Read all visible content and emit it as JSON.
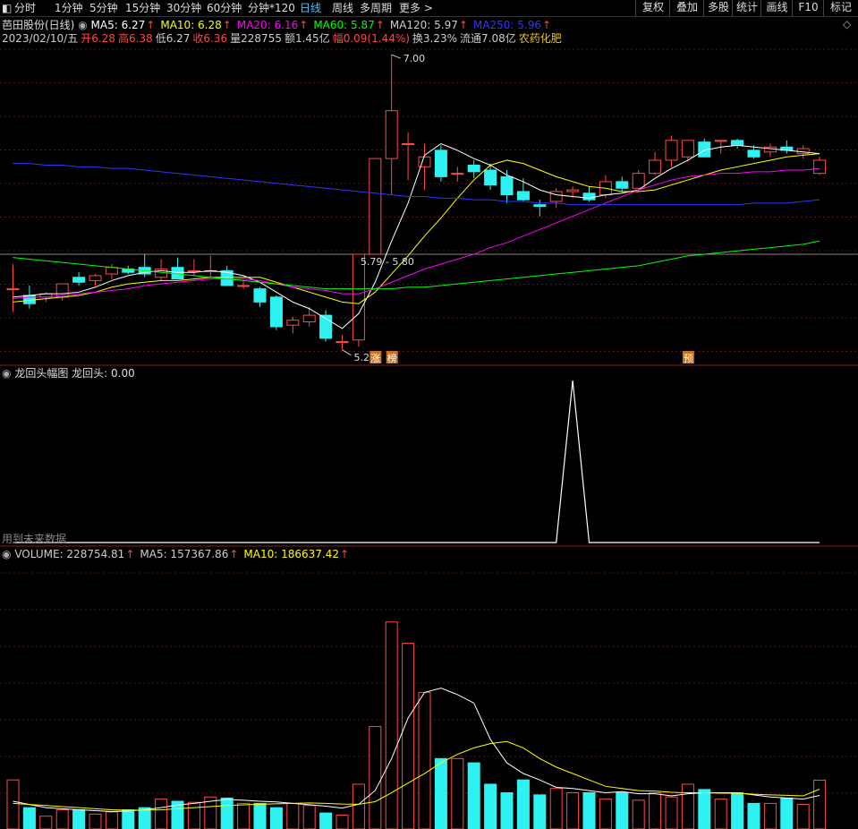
{
  "toolbar": {
    "periods": [
      "分时",
      "1分钟",
      "5分钟",
      "15分钟",
      "30分钟",
      "60分钟",
      "分钟*120",
      "日线",
      "周线",
      "多周期",
      "更多 >"
    ],
    "active": "日线",
    "right": [
      "复权",
      "叠加",
      "多股",
      "统计",
      "画线",
      "F10",
      "标记"
    ]
  },
  "header": {
    "title": "芭田股份(日线)",
    "ma": [
      {
        "label": "MA5: 6.27",
        "color": "#ffffff"
      },
      {
        "label": "MA10: 6.28",
        "color": "#ffff00"
      },
      {
        "label": "MA20: 6.16",
        "color": "#ff00ff"
      },
      {
        "label": "MA60: 5.87",
        "color": "#00ff00"
      },
      {
        "label": "MA120: 5.97",
        "color": "#cccccc"
      },
      {
        "label": "MA250: 5.96",
        "color": "#3333ff"
      }
    ],
    "quote": [
      {
        "text": "2023/02/10/五",
        "color": "#cccccc"
      },
      {
        "text": "开6.28",
        "color": "#ff4444"
      },
      {
        "text": "高6.38",
        "color": "#ff4444"
      },
      {
        "text": "低6.27",
        "color": "#cccccc"
      },
      {
        "text": "收6.36",
        "color": "#ff4444"
      },
      {
        "text": "量228755",
        "color": "#cccccc"
      },
      {
        "text": "额1.45亿",
        "color": "#cccccc"
      },
      {
        "text": "幅0.09(1.44%)",
        "color": "#ff4444"
      },
      {
        "text": "换3.23%",
        "color": "#cccccc"
      },
      {
        "text": "流通7.08亿",
        "color": "#cccccc"
      },
      {
        "text": "农药化肥",
        "color": "#e6c619"
      }
    ]
  },
  "panels": {
    "indicator_title": "龙回头幅图",
    "indicator_value": "龙回头: 0.00",
    "indicator_note": "用到未来数据",
    "volume": [
      {
        "text": "VOLUME: 228754.81",
        "color": "#cccccc"
      },
      {
        "text": "MA5: 157367.86",
        "color": "#cccccc"
      },
      {
        "text": "MA10: 186637.42",
        "color": "#ffff00"
      }
    ]
  },
  "annotations": {
    "high": "7.00",
    "low": "5.21",
    "range": "5.79 - 5.80",
    "tag_zhang": "涨",
    "tag_bang": "榜",
    "tag_yu": "预"
  },
  "chart_data": [
    {
      "type": "candlestick",
      "title": "芭田股份(日线)",
      "ylim": [
        5.16,
        7.06
      ],
      "candles": [
        {
          "o": 5.58,
          "h": 5.73,
          "l": 5.44,
          "c": 5.58
        },
        {
          "o": 5.54,
          "h": 5.6,
          "l": 5.46,
          "c": 5.49
        },
        {
          "o": 5.53,
          "h": 5.56,
          "l": 5.5,
          "c": 5.55
        },
        {
          "o": 5.53,
          "h": 5.61,
          "l": 5.51,
          "c": 5.61
        },
        {
          "o": 5.65,
          "h": 5.68,
          "l": 5.6,
          "c": 5.62
        },
        {
          "o": 5.63,
          "h": 5.67,
          "l": 5.6,
          "c": 5.66
        },
        {
          "o": 5.67,
          "h": 5.73,
          "l": 5.64,
          "c": 5.71
        },
        {
          "o": 5.7,
          "h": 5.72,
          "l": 5.67,
          "c": 5.68
        },
        {
          "o": 5.71,
          "h": 5.79,
          "l": 5.65,
          "c": 5.67
        },
        {
          "o": 5.65,
          "h": 5.76,
          "l": 5.63,
          "c": 5.7
        },
        {
          "o": 5.71,
          "h": 5.77,
          "l": 5.65,
          "c": 5.64
        },
        {
          "o": 5.69,
          "h": 5.76,
          "l": 5.66,
          "c": 5.69
        },
        {
          "o": 5.69,
          "h": 5.78,
          "l": 5.65,
          "c": 5.69
        },
        {
          "o": 5.69,
          "h": 5.72,
          "l": 5.66,
          "c": 5.6
        },
        {
          "o": 5.6,
          "h": 5.63,
          "l": 5.58,
          "c": 5.6
        },
        {
          "o": 5.58,
          "h": 5.59,
          "l": 5.47,
          "c": 5.5
        },
        {
          "o": 5.53,
          "h": 5.54,
          "l": 5.33,
          "c": 5.35
        },
        {
          "o": 5.36,
          "h": 5.41,
          "l": 5.31,
          "c": 5.39
        },
        {
          "o": 5.38,
          "h": 5.47,
          "l": 5.35,
          "c": 5.42
        },
        {
          "o": 5.42,
          "h": 5.45,
          "l": 5.26,
          "c": 5.28
        },
        {
          "o": 5.26,
          "h": 5.3,
          "l": 5.21,
          "c": 5.26
        },
        {
          "o": 5.27,
          "h": 5.79,
          "l": 5.23,
          "c": 5.79
        },
        {
          "o": 5.79,
          "h": 6.37,
          "l": 5.79,
          "c": 6.37
        },
        {
          "o": 6.37,
          "h": 7.0,
          "l": 6.15,
          "c": 6.66
        },
        {
          "o": 6.46,
          "h": 6.53,
          "l": 6.24,
          "c": 6.46
        },
        {
          "o": 6.32,
          "h": 6.46,
          "l": 6.18,
          "c": 6.38
        },
        {
          "o": 6.42,
          "h": 6.45,
          "l": 6.23,
          "c": 6.26
        },
        {
          "o": 6.28,
          "h": 6.32,
          "l": 6.23,
          "c": 6.28
        },
        {
          "o": 6.33,
          "h": 6.36,
          "l": 6.25,
          "c": 6.29
        },
        {
          "o": 6.3,
          "h": 6.34,
          "l": 6.18,
          "c": 6.21
        },
        {
          "o": 6.26,
          "h": 6.3,
          "l": 6.1,
          "c": 6.15
        },
        {
          "o": 6.17,
          "h": 6.25,
          "l": 6.11,
          "c": 6.12
        },
        {
          "o": 6.09,
          "h": 6.12,
          "l": 6.02,
          "c": 6.08
        },
        {
          "o": 6.11,
          "h": 6.19,
          "l": 6.07,
          "c": 6.17
        },
        {
          "o": 6.17,
          "h": 6.2,
          "l": 6.13,
          "c": 6.18
        },
        {
          "o": 6.16,
          "h": 6.2,
          "l": 6.11,
          "c": 6.12
        },
        {
          "o": 6.15,
          "h": 6.27,
          "l": 6.13,
          "c": 6.23
        },
        {
          "o": 6.23,
          "h": 6.26,
          "l": 6.17,
          "c": 6.19
        },
        {
          "o": 6.19,
          "h": 6.3,
          "l": 6.17,
          "c": 6.28
        },
        {
          "o": 6.28,
          "h": 6.41,
          "l": 6.27,
          "c": 6.36
        },
        {
          "o": 6.36,
          "h": 6.51,
          "l": 6.32,
          "c": 6.48
        },
        {
          "o": 6.38,
          "h": 6.48,
          "l": 6.35,
          "c": 6.48
        },
        {
          "o": 6.47,
          "h": 6.49,
          "l": 6.38,
          "c": 6.38
        },
        {
          "o": 6.48,
          "h": 6.48,
          "l": 6.4,
          "c": 6.48
        },
        {
          "o": 6.48,
          "h": 6.49,
          "l": 6.43,
          "c": 6.45
        },
        {
          "o": 6.42,
          "h": 6.45,
          "l": 6.37,
          "c": 6.38
        },
        {
          "o": 6.41,
          "h": 6.46,
          "l": 6.38,
          "c": 6.44
        },
        {
          "o": 6.44,
          "h": 6.48,
          "l": 6.4,
          "c": 6.42
        },
        {
          "o": 6.4,
          "h": 6.45,
          "l": 6.37,
          "c": 6.43
        },
        {
          "o": 6.28,
          "h": 6.38,
          "l": 6.27,
          "c": 6.36
        }
      ],
      "ma_series": [
        {
          "name": "MA5",
          "color": "#ffffff",
          "values": [
            5.53,
            5.54,
            5.55,
            5.55,
            5.56,
            5.59,
            5.63,
            5.66,
            5.68,
            5.69,
            5.68,
            5.68,
            5.69,
            5.68,
            5.66,
            5.62,
            5.56,
            5.5,
            5.46,
            5.4,
            5.34,
            5.43,
            5.62,
            5.87,
            6.1,
            6.39,
            6.46,
            6.42,
            6.37,
            6.33,
            6.27,
            6.23,
            6.18,
            6.15,
            6.14,
            6.13,
            6.15,
            6.16,
            6.18,
            6.25,
            6.31,
            6.36,
            6.42,
            6.44,
            6.45,
            6.44,
            6.43,
            6.42,
            6.41,
            6.4
          ]
        },
        {
          "name": "MA10",
          "color": "#ffff00",
          "values": [
            5.5,
            5.51,
            5.52,
            5.53,
            5.54,
            5.56,
            5.59,
            5.61,
            5.62,
            5.63,
            5.63,
            5.64,
            5.65,
            5.65,
            5.65,
            5.65,
            5.62,
            5.59,
            5.56,
            5.53,
            5.5,
            5.49,
            5.56,
            5.67,
            5.78,
            5.9,
            6.01,
            6.13,
            6.24,
            6.33,
            6.36,
            6.34,
            6.3,
            6.26,
            6.23,
            6.2,
            6.19,
            6.17,
            6.17,
            6.18,
            6.21,
            6.24,
            6.27,
            6.3,
            6.32,
            6.34,
            6.36,
            6.38,
            6.39,
            6.4
          ]
        },
        {
          "name": "MA20",
          "color": "#ff00ff",
          "values": [
            5.52,
            5.53,
            5.53,
            5.54,
            5.55,
            5.56,
            5.57,
            5.58,
            5.6,
            5.61,
            5.62,
            5.63,
            5.64,
            5.64,
            5.64,
            5.63,
            5.61,
            5.59,
            5.58,
            5.57,
            5.55,
            5.55,
            5.58,
            5.62,
            5.66,
            5.7,
            5.73,
            5.76,
            5.79,
            5.83,
            5.86,
            5.9,
            5.94,
            5.98,
            6.02,
            6.06,
            6.1,
            6.14,
            6.18,
            6.21,
            6.24,
            6.26,
            6.27,
            6.28,
            6.28,
            6.29,
            6.29,
            6.3,
            6.3,
            6.31
          ]
        },
        {
          "name": "MA60",
          "color": "#00ff00",
          "values": [
            5.77,
            5.76,
            5.75,
            5.74,
            5.73,
            5.72,
            5.71,
            5.7,
            5.69,
            5.68,
            5.67,
            5.66,
            5.65,
            5.64,
            5.63,
            5.62,
            5.61,
            5.6,
            5.59,
            5.58,
            5.58,
            5.58,
            5.58,
            5.58,
            5.59,
            5.59,
            5.6,
            5.61,
            5.62,
            5.63,
            5.64,
            5.65,
            5.66,
            5.67,
            5.68,
            5.69,
            5.7,
            5.71,
            5.72,
            5.74,
            5.76,
            5.78,
            5.79,
            5.8,
            5.81,
            5.82,
            5.83,
            5.84,
            5.85,
            5.87
          ]
        },
        {
          "name": "MA250",
          "color": "#3333ff",
          "values": [
            6.34,
            6.34,
            6.33,
            6.33,
            6.32,
            6.32,
            6.31,
            6.31,
            6.3,
            6.29,
            6.28,
            6.27,
            6.26,
            6.25,
            6.24,
            6.23,
            6.22,
            6.21,
            6.2,
            6.19,
            6.18,
            6.17,
            6.16,
            6.15,
            6.14,
            6.14,
            6.13,
            6.13,
            6.12,
            6.12,
            6.11,
            6.11,
            6.1,
            6.1,
            6.09,
            6.09,
            6.09,
            6.09,
            6.09,
            6.09,
            6.09,
            6.09,
            6.09,
            6.09,
            6.09,
            6.1,
            6.1,
            6.1,
            6.11,
            6.12
          ]
        }
      ]
    },
    {
      "type": "line",
      "title": "龙回头",
      "values": [
        0,
        0,
        0,
        0,
        0,
        0,
        0,
        0,
        0,
        0,
        0,
        0,
        0,
        0,
        0,
        0,
        0,
        0,
        0,
        0,
        0,
        0,
        0,
        0,
        0,
        0,
        0,
        0,
        0,
        0,
        0,
        0,
        0,
        0,
        1,
        0,
        0,
        0,
        0,
        0,
        0,
        0,
        0,
        0,
        0,
        0,
        0,
        0,
        0,
        0
      ],
      "ylim": [
        0,
        1
      ]
    },
    {
      "type": "bar",
      "title": "VOLUME",
      "ylim": [
        0,
        1250000
      ],
      "values": [
        230000,
        100000,
        60000,
        90000,
        90000,
        70000,
        80000,
        90000,
        100000,
        140000,
        130000,
        125000,
        150000,
        145000,
        120000,
        120000,
        100000,
        120000,
        110000,
        75000,
        65000,
        210000,
        480000,
        970000,
        870000,
        640000,
        330000,
        330000,
        310000,
        210000,
        170000,
        230000,
        160000,
        190000,
        170000,
        170000,
        140000,
        170000,
        135000,
        170000,
        150000,
        210000,
        185000,
        140000,
        170000,
        120000,
        120000,
        145000,
        115000,
        228755
      ],
      "ma_series": [
        {
          "name": "MA5",
          "color": "#ffffff",
          "values": [
            130000,
            115000,
            100000,
            95000,
            90000,
            86000,
            82000,
            84000,
            90000,
            100000,
            112000,
            120000,
            130000,
            138000,
            135000,
            130000,
            127000,
            120000,
            114000,
            107000,
            98000,
            116000,
            180000,
            330000,
            520000,
            640000,
            660000,
            630000,
            590000,
            420000,
            310000,
            260000,
            230000,
            195000,
            190000,
            180000,
            170000,
            175000,
            165000,
            165000,
            155000,
            165000,
            170000,
            170000,
            170000,
            160000,
            150000,
            145000,
            140000,
            157368
          ]
        },
        {
          "name": "MA10",
          "color": "#ffff00",
          "values": [
            120000,
            115000,
            110000,
            105000,
            100000,
            95000,
            90000,
            88000,
            88000,
            90000,
            95000,
            100000,
            105000,
            110000,
            113000,
            116000,
            118000,
            120000,
            122000,
            120000,
            117000,
            116000,
            128000,
            170000,
            215000,
            260000,
            310000,
            350000,
            380000,
            400000,
            410000,
            380000,
            330000,
            290000,
            260000,
            230000,
            200000,
            190000,
            180000,
            178000,
            172000,
            170000,
            170000,
            168000,
            168000,
            163000,
            160000,
            158000,
            155000,
            186637
          ]
        }
      ]
    }
  ]
}
